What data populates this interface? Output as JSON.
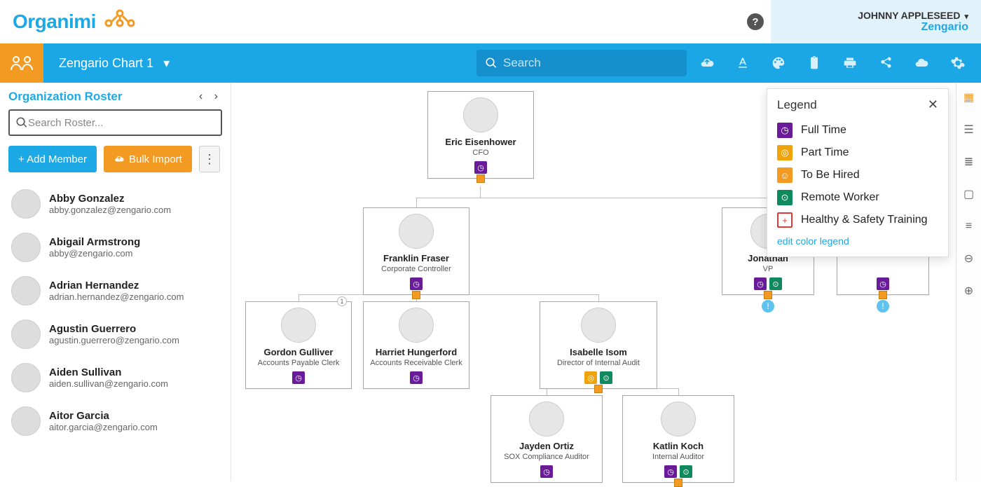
{
  "brand": {
    "name": "Organimi"
  },
  "header": {
    "user_name": "JOHNNY APPLESEED",
    "user_org": "Zengario"
  },
  "toolbar": {
    "chart_name": "Zengario Chart 1",
    "search_placeholder": "Search",
    "icons": [
      "cloud-upload",
      "text-format",
      "palette",
      "clipboard",
      "print",
      "share",
      "cloud-download",
      "settings"
    ]
  },
  "sidebar": {
    "title": "Organization Roster",
    "search_placeholder": "Search Roster...",
    "add_member_label": "+ Add Member",
    "bulk_import_label": "Bulk Import",
    "roster": [
      {
        "name": "Abby Gonzalez",
        "email": "abby.gonzalez@zengario.com"
      },
      {
        "name": "Abigail Armstrong",
        "email": "abby@zengario.com"
      },
      {
        "name": "Adrian Hernandez",
        "email": "adrian.hernandez@zengario.com"
      },
      {
        "name": "Agustin Guerrero",
        "email": "agustin.guerrero@zengario.com"
      },
      {
        "name": "Aiden Sullivan",
        "email": "aiden.sullivan@zengario.com"
      },
      {
        "name": "Aitor Garcia",
        "email": "aitor.garcia@zengario.com"
      }
    ]
  },
  "legend": {
    "title": "Legend",
    "edit_label": "edit color legend",
    "items": [
      {
        "label": "Full Time",
        "color": "#6a1b9a",
        "glyph": "◷"
      },
      {
        "label": "Part Time",
        "color": "#f0a30a",
        "glyph": "◎"
      },
      {
        "label": "To Be Hired",
        "color": "#f29a22",
        "glyph": "☺"
      },
      {
        "label": "Remote Worker",
        "color": "#0f8a5f",
        "glyph": "⊙"
      },
      {
        "label": "Healthy & Safety Training",
        "color": "#ffffff",
        "glyph": "+",
        "border": "#e53935",
        "fg": "#e53935"
      }
    ]
  },
  "chart": {
    "nodes": {
      "n0": {
        "name": "Eric Eisenhower",
        "role": "CFO",
        "badges": [
          "full-time"
        ]
      },
      "n1": {
        "name": "Franklin Fraser",
        "role": "Corporate Controller",
        "badges": [
          "full-time"
        ]
      },
      "n2": {
        "name": "Jonathan",
        "role": "VP",
        "badges": [
          "full-time",
          "remote"
        ]
      },
      "n3": {
        "name": "Gordon Gulliver",
        "role": "Accounts Payable Clerk",
        "badges": [
          "full-time"
        ]
      },
      "n4": {
        "name": "Harriet Hungerford",
        "role": "Accounts Receivable Clerk",
        "badges": [
          "full-time"
        ]
      },
      "n5": {
        "name": "Isabelle Isom",
        "role": "Director of Internal Audit",
        "badges": [
          "part-time",
          "remote"
        ]
      },
      "n6": {
        "name": "Jayden Ortiz",
        "role": "SOX Compliance Auditor",
        "badges": [
          "full-time"
        ]
      },
      "n7": {
        "name": "Katlin Koch",
        "role": "Internal Auditor",
        "badges": [
          "full-time",
          "remote"
        ]
      }
    }
  }
}
